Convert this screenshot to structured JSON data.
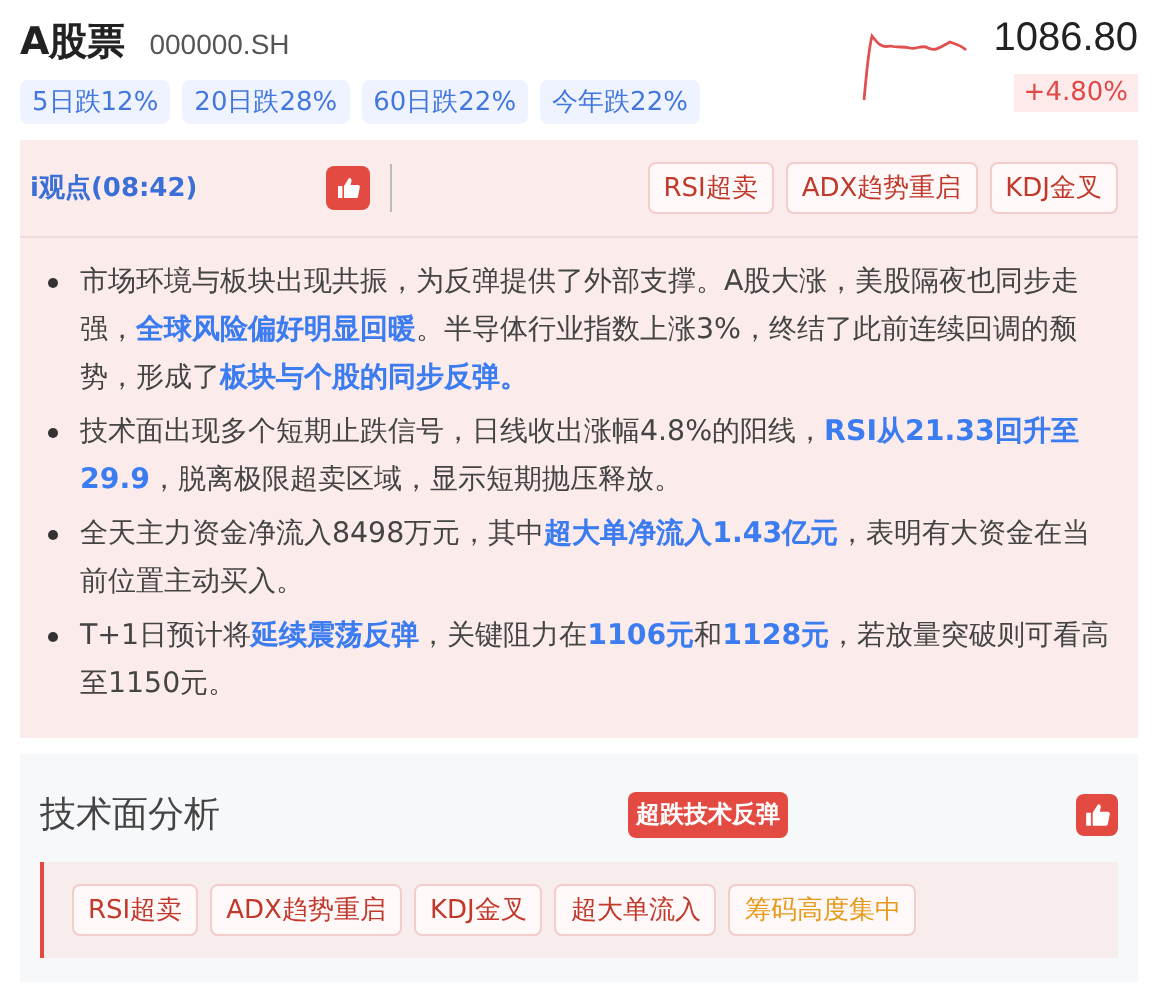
{
  "stock": {
    "name": "A股票",
    "code": "000000.SH",
    "price": "1086.80",
    "change": "+4.80%"
  },
  "period_chips": [
    "5日跌12%",
    "20日跌28%",
    "60日跌22%",
    "今年跌22%"
  ],
  "viewpoint": {
    "title": "i观点(08:42)",
    "liked": true,
    "tags": [
      {
        "label": "RSI超卖",
        "color": "#c0392b"
      },
      {
        "label": "ADX趋势重启",
        "color": "#c0392b"
      },
      {
        "label": "KDJ金叉",
        "color": "#c0392b"
      }
    ],
    "points": [
      "市场环境与板块出现共振，为反弹提供了外部支撑。A股大涨，美股隔夜也同步走强，**全球风险偏好明显回暖**。半导体行业指数上涨3%，终结了此前连续回调的颓势，形成了**板块与个股的同步反弹。**",
      "技术面出现多个短期止跌信号，日线收出涨幅4.8%的阳线，**RSI从21.33回升至29.9**，脱离极限超卖区域，显示短期抛压释放。",
      "全天主力资金净流入8498万元，其中**超大单净流入1.43亿元**，表明有大资金在当前位置主动买入。",
      "T+1日预计将**延续震荡反弹**，关键阻力在**1106元**和**1128元**，若放量突破则可看高至1150元。"
    ]
  },
  "technical": {
    "title": "技术面分析",
    "badge": "超跌技术反弹",
    "liked": true,
    "tags": [
      {
        "label": "RSI超卖",
        "color": "#c0392b"
      },
      {
        "label": "ADX趋势重启",
        "color": "#c0392b"
      },
      {
        "label": "KDJ金叉",
        "color": "#c0392b"
      },
      {
        "label": "超大单流入",
        "color": "#c0392b"
      },
      {
        "label": "筹码高度集中",
        "color": "#e69a1a"
      }
    ]
  }
}
